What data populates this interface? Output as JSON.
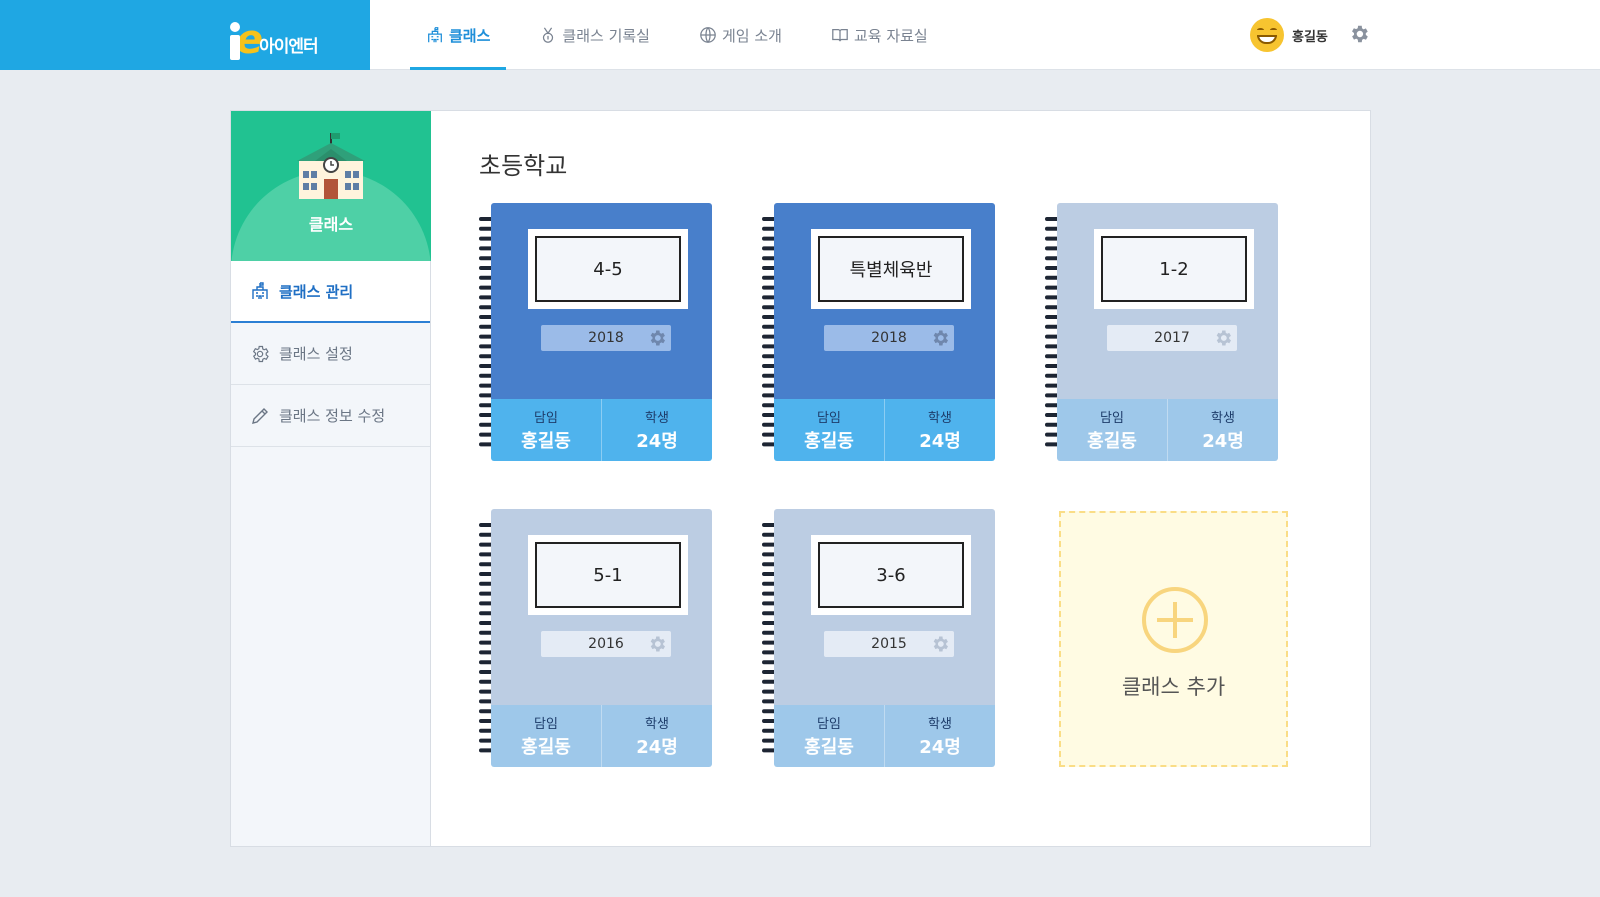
{
  "brand": {
    "logo_text": "아이엔터"
  },
  "nav": {
    "items": [
      {
        "label": "클래스",
        "icon": "class-icon",
        "active": true
      },
      {
        "label": "클래스 기록실",
        "icon": "medal-icon",
        "active": false
      },
      {
        "label": "게임 소개",
        "icon": "globe-icon",
        "active": false
      },
      {
        "label": "교육 자료실",
        "icon": "book-icon",
        "active": false
      }
    ]
  },
  "user": {
    "name": "홍길동",
    "avatar": "smiley-avatar"
  },
  "sidebar": {
    "header_label": "클래스",
    "items": [
      {
        "label": "클래스 관리",
        "icon": "class-icon",
        "active": true
      },
      {
        "label": "클래스 설정",
        "icon": "gear-icon",
        "active": false
      },
      {
        "label": "클래스 정보 수정",
        "icon": "pencil-icon",
        "active": false
      }
    ]
  },
  "main": {
    "title": "초등학교",
    "classes": [
      {
        "name": "4-5",
        "year": "2018",
        "teacher_label": "담임",
        "teacher": "홍길동",
        "students_label": "학생",
        "students": "24명",
        "current": true
      },
      {
        "name": "특별체육반",
        "year": "2018",
        "teacher_label": "담임",
        "teacher": "홍길동",
        "students_label": "학생",
        "students": "24명",
        "current": true
      },
      {
        "name": "1-2",
        "year": "2017",
        "teacher_label": "담임",
        "teacher": "홍길동",
        "students_label": "학생",
        "students": "24명",
        "current": false
      },
      {
        "name": "5-1",
        "year": "2016",
        "teacher_label": "담임",
        "teacher": "홍길동",
        "students_label": "학생",
        "students": "24명",
        "current": false
      },
      {
        "name": "3-6",
        "year": "2015",
        "teacher_label": "담임",
        "teacher": "홍길동",
        "students_label": "학생",
        "students": "24명",
        "current": false
      }
    ],
    "add_label": "클래스 추가"
  },
  "colors": {
    "brand_blue": "#1fa7e3",
    "sidebar_green": "#21c291",
    "card_current": "#487fcb",
    "card_past": "#bccde3",
    "add_yellow": "#fffbe3"
  }
}
